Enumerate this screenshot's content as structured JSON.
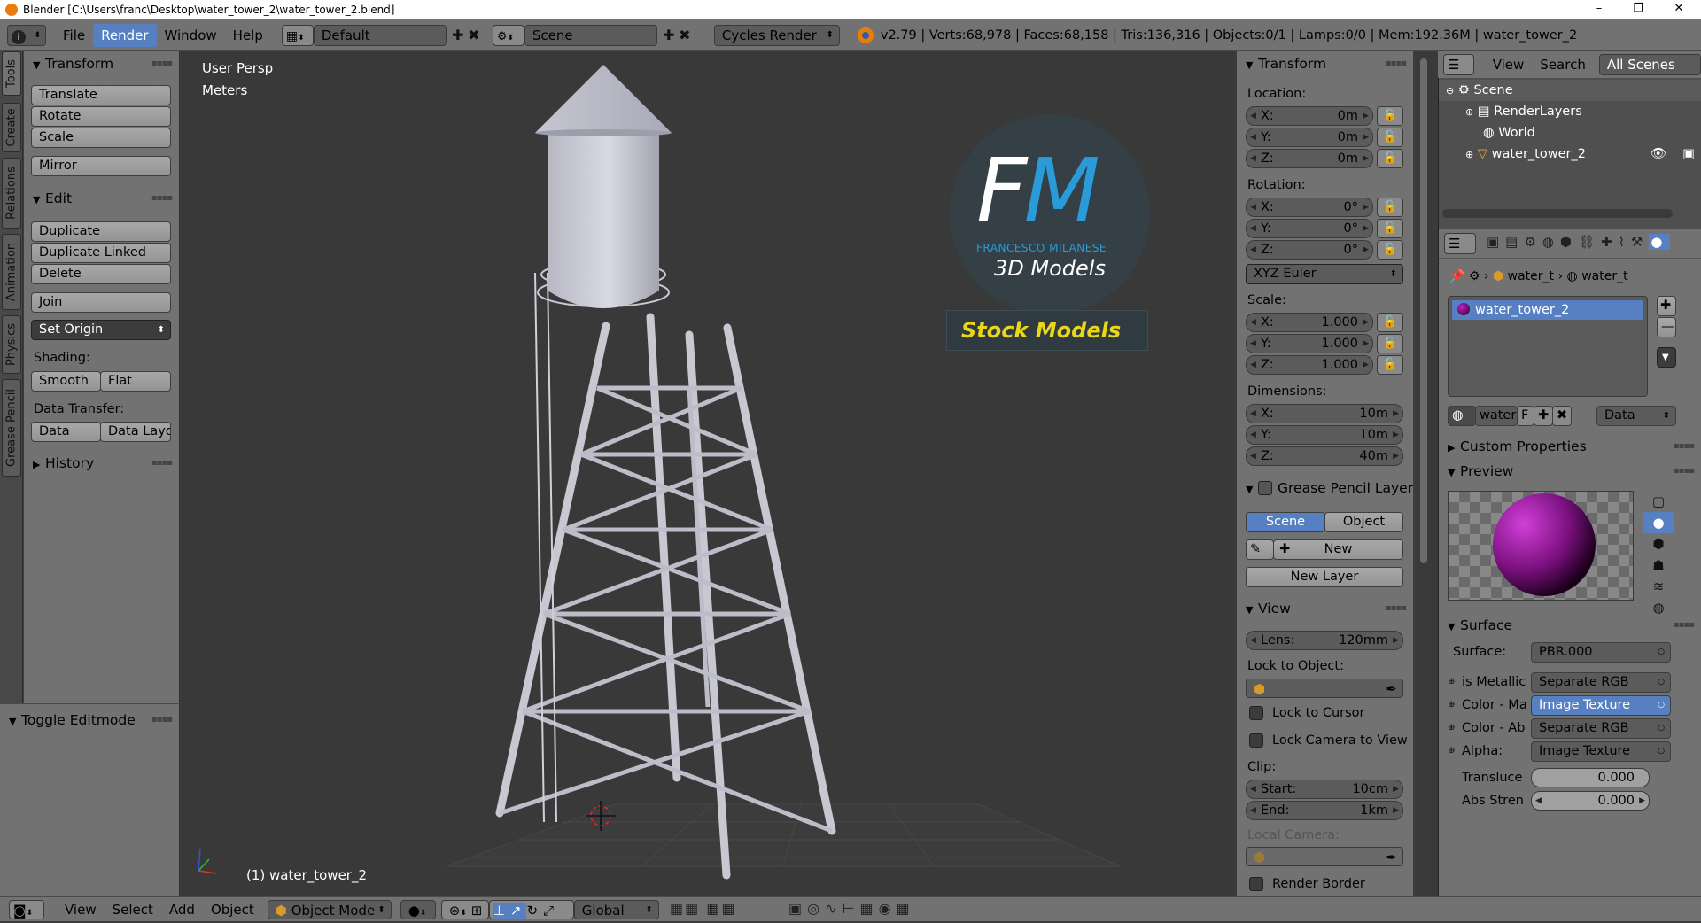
{
  "window": {
    "title": "Blender [C:\\Users\\franc\\Desktop\\water_tower_2\\water_tower_2.blend]",
    "minimize": "–",
    "maximize": "❐",
    "close": "✕"
  },
  "info_header": {
    "menus": [
      "File",
      "Render",
      "Window",
      "Help"
    ],
    "active_menu": "Render",
    "screen_layout": "Default",
    "scene": "Scene",
    "render_engine": "Cycles Render",
    "stats": "v2.79 | Verts:68,978 | Faces:68,158 | Tris:136,316 | Objects:0/1 | Lamps:0/0 | Mem:192.36M | water_tower_2"
  },
  "tool_tabs": [
    "Tools",
    "Create",
    "Relations",
    "Animation",
    "Physics",
    "Grease Pencil"
  ],
  "tool_shelf": {
    "transform_header": "Transform",
    "translate": "Translate",
    "rotate": "Rotate",
    "scale": "Scale",
    "mirror": "Mirror",
    "edit_header": "Edit",
    "duplicate": "Duplicate",
    "duplicate_linked": "Duplicate Linked",
    "delete": "Delete",
    "join": "Join",
    "set_origin": "Set Origin",
    "shading_label": "Shading:",
    "smooth": "Smooth",
    "flat": "Flat",
    "data_transfer_label": "Data Transfer:",
    "data": "Data",
    "data_layout": "Data Layo",
    "history_header": "History",
    "toggle_editmode": "Toggle Editmode"
  },
  "viewport": {
    "view_name": "User Persp",
    "units": "Meters",
    "object_label": "(1) water_tower_2",
    "logo_fm": "FM",
    "logo_name": "FRANCESCO MILANESE",
    "logo_sub": "3D Models",
    "stock_label": "Stock Models"
  },
  "n_panel": {
    "transform_header": "Transform",
    "location_label": "Location:",
    "location": {
      "x": "0m",
      "y": "0m",
      "z": "0m"
    },
    "rotation_label": "Rotation:",
    "rotation": {
      "x": "0°",
      "y": "0°",
      "z": "0°"
    },
    "rotation_mode": "XYZ Euler",
    "scale_label": "Scale:",
    "scale": {
      "x": "1.000",
      "y": "1.000",
      "z": "1.000"
    },
    "dimensions_label": "Dimensions:",
    "dimensions": {
      "x": "10m",
      "y": "10m",
      "z": "40m"
    },
    "axis_x": "X:",
    "axis_y": "Y:",
    "axis_z": "Z:",
    "grease_pencil_header": "Grease Pencil Layer",
    "gp_scene": "Scene",
    "gp_object": "Object",
    "gp_new": "New",
    "gp_new_layer": "New Layer",
    "view_header": "View",
    "lens_label": "Lens:",
    "lens_value": "120mm",
    "lock_to_object_label": "Lock to Object:",
    "lock_to_cursor": "Lock to Cursor",
    "lock_camera_to_view": "Lock Camera to View",
    "clip_label": "Clip:",
    "clip_start_label": "Start:",
    "clip_start": "10cm",
    "clip_end_label": "End:",
    "clip_end": "1km",
    "local_camera_label": "Local Camera:",
    "render_border": "Render Border"
  },
  "outliner": {
    "view": "View",
    "search": "Search",
    "filter": "All Scenes",
    "items": [
      "Scene",
      "RenderLayers",
      "World",
      "water_tower_2"
    ]
  },
  "properties": {
    "breadcrumb_object": "water_t",
    "breadcrumb_material": "water_t",
    "material_slot": "water_tower_2",
    "material_name": "water",
    "material_f": "F",
    "link_mode": "Data",
    "custom_properties": "Custom Properties",
    "preview_header": "Preview",
    "surface_header": "Surface",
    "surface_label": "Surface:",
    "surface_value": "PBR.000",
    "rows": [
      {
        "label": "is Metallic",
        "value": "Separate RGB"
      },
      {
        "label": "Color - Ma",
        "value": "Image Texture"
      },
      {
        "label": "Color - Ab",
        "value": "Separate RGB"
      },
      {
        "label": "Alpha:",
        "value": "Image Texture"
      }
    ],
    "translucence_label": "Transluce",
    "translucence_value": "0.000",
    "abs_strength_label": "Abs Stren",
    "abs_strength_value": "0.000"
  },
  "bottom_header": {
    "menus": [
      "View",
      "Select",
      "Add",
      "Object"
    ],
    "mode": "Object Mode",
    "orientation": "Global"
  },
  "colors": {
    "accent_blue": "#5680c2",
    "panel_gray": "#727272",
    "viewport_bg": "#393939",
    "material_purple": "#c020c8",
    "stock_yellow": "#e8d818"
  }
}
